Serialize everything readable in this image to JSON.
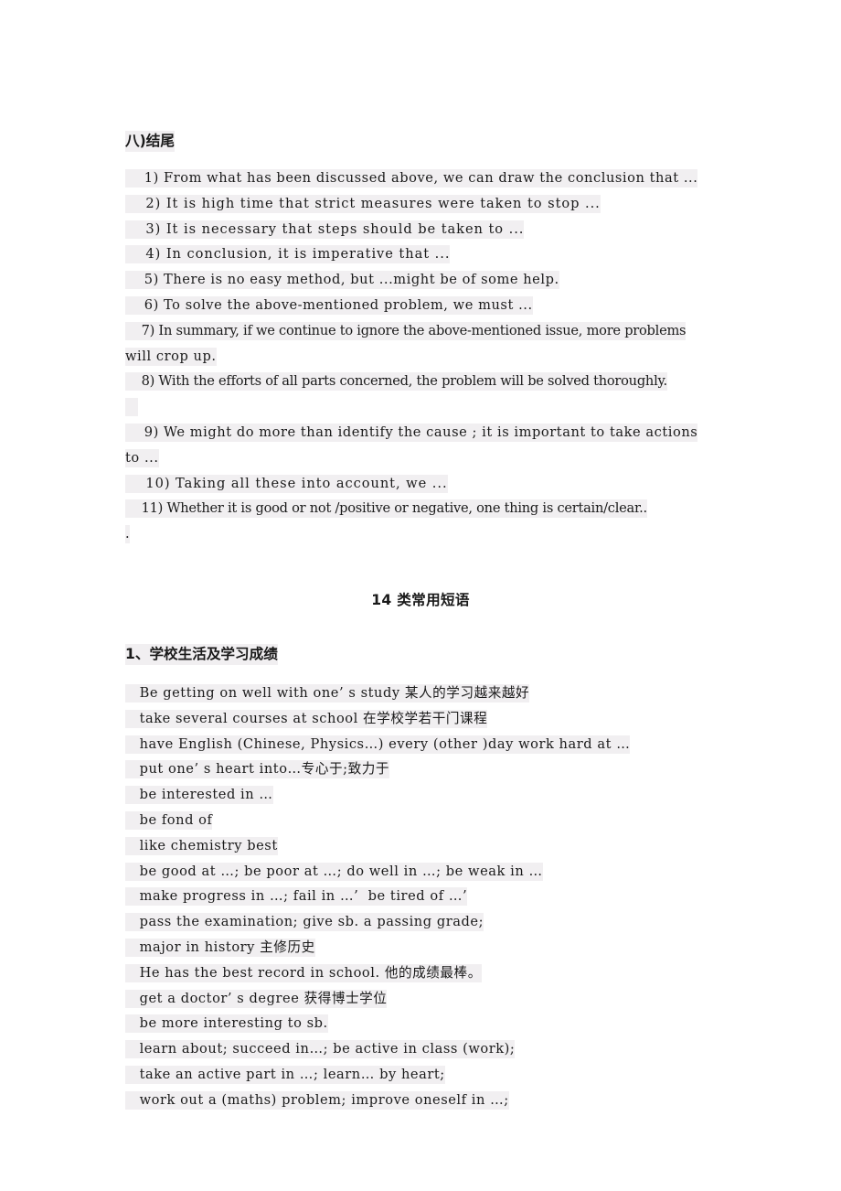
{
  "document": {
    "section_ending": {
      "heading": "八)结尾",
      "items": [
        "1) From what has been discussed above, we can draw the conclusion that ...",
        "2) It is high time that strict measures were taken to stop ...",
        "3) It is necessary that steps should be taken to ...",
        "4) In conclusion, it is imperative that ...",
        "5) There is no easy method, but ...might be of some help.",
        "6) To solve the above-mentioned problem, we must ...",
        "7) In summary, if we continue to ignore the above-mentioned issue, more problems will crop up.",
        "8) With the efforts of all parts concerned, the problem will be solved thoroughly.",
        "9) We might do more than identify the cause ; it is important to take actions to ...",
        "10) Taking all these into account, we ...",
        "11) Whether it is good or not /positive or negative, one thing is certain/clear..."
      ],
      "item_lines": [
        {
          "text": "1) From what has been discussed above, we can draw the conclusion that ...",
          "style": "loose2"
        },
        {
          "text": "2) It is high time that strict measures were taken to stop ...",
          "style": "loose"
        },
        {
          "text": "3) It is necessary that steps should be taken to ...",
          "style": "loose"
        },
        {
          "text": "4) In conclusion, it is imperative that ...",
          "style": "loose"
        },
        {
          "text": "5) There is no easy method, but ...might be of some help.",
          "style": "loose2"
        },
        {
          "text": "6) To solve the above-mentioned problem, we must ...",
          "style": "loose2"
        },
        {
          "text": "7) In summary, if we continue to ignore the above-mentioned issue, more problems",
          "style": "tight"
        },
        {
          "text": "will crop up.",
          "style": "loose2"
        },
        {
          "text": "8) With the efforts of all parts concerned, the problem will be solved thoroughly.",
          "style": "tight"
        },
        {
          "text": "",
          "style": "blank"
        },
        {
          "text": "9) We might do more than identify the cause ; it is important to take actions",
          "style": "loose2"
        },
        {
          "text": "to ...",
          "style": "loose2"
        },
        {
          "text": "10) Taking all these into account, we ...",
          "style": "loose"
        },
        {
          "text": "11) Whether it is good or not /positive or negative, one thing is certain/clear..",
          "style": "tight"
        },
        {
          "text": ".",
          "style": "loose2"
        }
      ]
    },
    "title": "14 类常用短语",
    "section_school": {
      "heading": "1、学校生活及学习成绩",
      "phrases": [
        "Be getting on well with one’ s study 某人的学习越来越好",
        "take several courses at school 在学校学若干门课程",
        "have English (Chinese, Physics…) every (other )day work hard at …",
        "put one’ s heart into…专心于;致力于",
        "be interested in …",
        "be fond of",
        "like chemistry best",
        "be good at …; be poor at …; do well in …; be weak in …",
        "make progress in …; fail in …’  be tired of …’",
        "pass the examination; give sb. a passing grade;",
        "major in history 主修历史",
        "He has the best record in school. 他的成绩最棒。",
        "get a doctor’ s degree 获得博士学位",
        "be more interesting to sb.",
        "learn about; succeed in…; be active in class (work);",
        "take an active part in …; learn… by heart;",
        "work out a (maths) problem; improve oneself in …;"
      ]
    }
  },
  "indents": {
    "item": "    ",
    "phrase": "   ",
    "heading": "   "
  },
  "colors": {
    "highlight": "#f1eff1",
    "text": "#1a1a1a",
    "page": "#ffffff"
  }
}
